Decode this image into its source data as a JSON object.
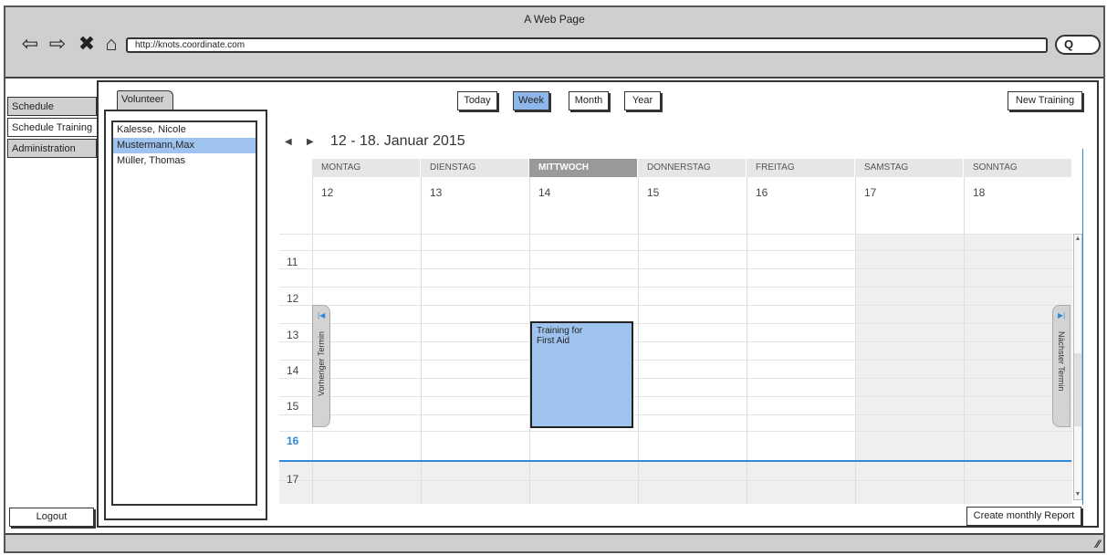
{
  "browser": {
    "window_title": "A Web Page",
    "url": "http://knots.coordinate.com",
    "search_icon_glyph": "Q"
  },
  "sidebar": {
    "items": [
      {
        "label": "Schedule"
      },
      {
        "label": "Schedule Training"
      },
      {
        "label": "Administration"
      }
    ],
    "logout_label": "Logout"
  },
  "volunteer": {
    "tab_label": "Volunteer",
    "items": [
      {
        "label": "Kalesse, Nicole"
      },
      {
        "label": "Mustermann,Max"
      },
      {
        "label": "Müller, Thomas"
      }
    ]
  },
  "toolbar": {
    "today": "Today",
    "week": "Week",
    "month": "Month",
    "year": "Year",
    "new_training": "New Training"
  },
  "calendar": {
    "range_title": "12 - 18. Januar 2015",
    "days": [
      {
        "name": "MONTAG",
        "date": "12"
      },
      {
        "name": "DIENSTAG",
        "date": "13"
      },
      {
        "name": "MITTWOCH",
        "date": "14"
      },
      {
        "name": "DONNERSTAG",
        "date": "15"
      },
      {
        "name": "FREITAG",
        "date": "16"
      },
      {
        "name": "SAMSTAG",
        "date": "17"
      },
      {
        "name": "SONNTAG",
        "date": "18"
      }
    ],
    "hours": [
      "11",
      "12",
      "13",
      "14",
      "15",
      "16",
      "17"
    ],
    "event": {
      "title_line1": "Training for",
      "title_line2": "First Aid"
    },
    "prev_label": "Vorheriger Termin",
    "next_label": "Nächster Termin",
    "colors": {
      "accent": "#9fc3ef",
      "now_line": "#2f8ad8",
      "selected_day_header": "#999999"
    }
  },
  "footer": {
    "report_button": "Create monthly Report"
  }
}
